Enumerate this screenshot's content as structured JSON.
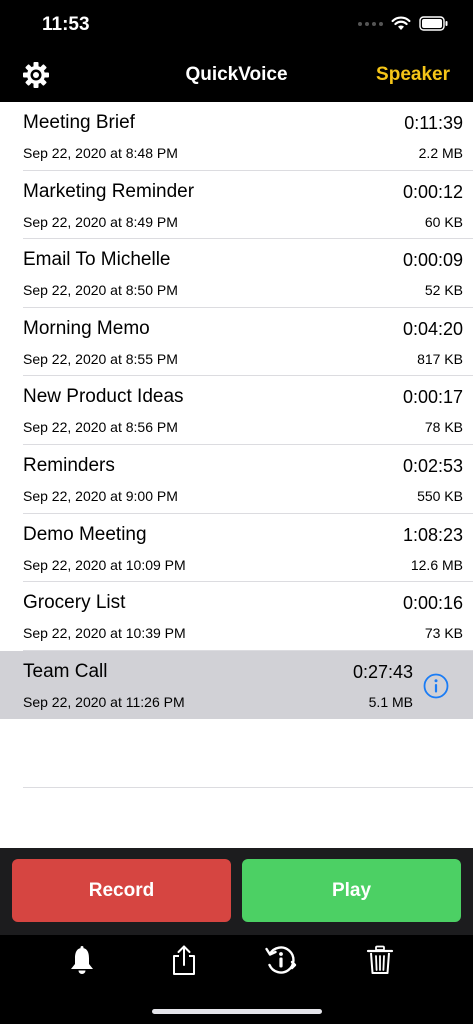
{
  "status": {
    "time": "11:53"
  },
  "nav": {
    "title": "QuickVoice",
    "speaker_label": "Speaker"
  },
  "recordings": [
    {
      "name": "Meeting Brief",
      "date": "Sep 22, 2020 at 8:48 PM",
      "duration": "0:11:39",
      "size": "2.2 MB"
    },
    {
      "name": "Marketing Reminder",
      "date": "Sep 22, 2020 at 8:49 PM",
      "duration": "0:00:12",
      "size": "60 KB"
    },
    {
      "name": "Email To Michelle",
      "date": "Sep 22, 2020 at 8:50 PM",
      "duration": "0:00:09",
      "size": "52 KB"
    },
    {
      "name": "Morning Memo",
      "date": "Sep 22, 2020 at 8:55 PM",
      "duration": "0:04:20",
      "size": "817 KB"
    },
    {
      "name": "New Product Ideas",
      "date": "Sep 22, 2020 at 8:56 PM",
      "duration": "0:00:17",
      "size": "78 KB"
    },
    {
      "name": "Reminders",
      "date": "Sep 22, 2020 at 9:00 PM",
      "duration": "0:02:53",
      "size": "550 KB"
    },
    {
      "name": "Demo Meeting",
      "date": "Sep 22, 2020 at 10:09 PM",
      "duration": "1:08:23",
      "size": "12.6 MB"
    },
    {
      "name": "Grocery List",
      "date": "Sep 22, 2020 at 10:39 PM",
      "duration": "0:00:16",
      "size": "73 KB"
    },
    {
      "name": "Team Call",
      "date": "Sep 22, 2020 at 11:26 PM",
      "duration": "0:27:43",
      "size": "5.1 MB"
    }
  ],
  "actions": {
    "record_label": "Record",
    "play_label": "Play"
  },
  "colors": {
    "record": "#d64541",
    "play": "#4cd064",
    "speaker": "#f5c518",
    "info": "#1a7cf5",
    "selected_row": "#d1d1d6"
  },
  "icons": {
    "settings": "gear-icon",
    "info": "info-icon",
    "alarm": "bell-icon",
    "share": "share-icon",
    "history": "history-info-icon",
    "delete": "trash-icon"
  }
}
